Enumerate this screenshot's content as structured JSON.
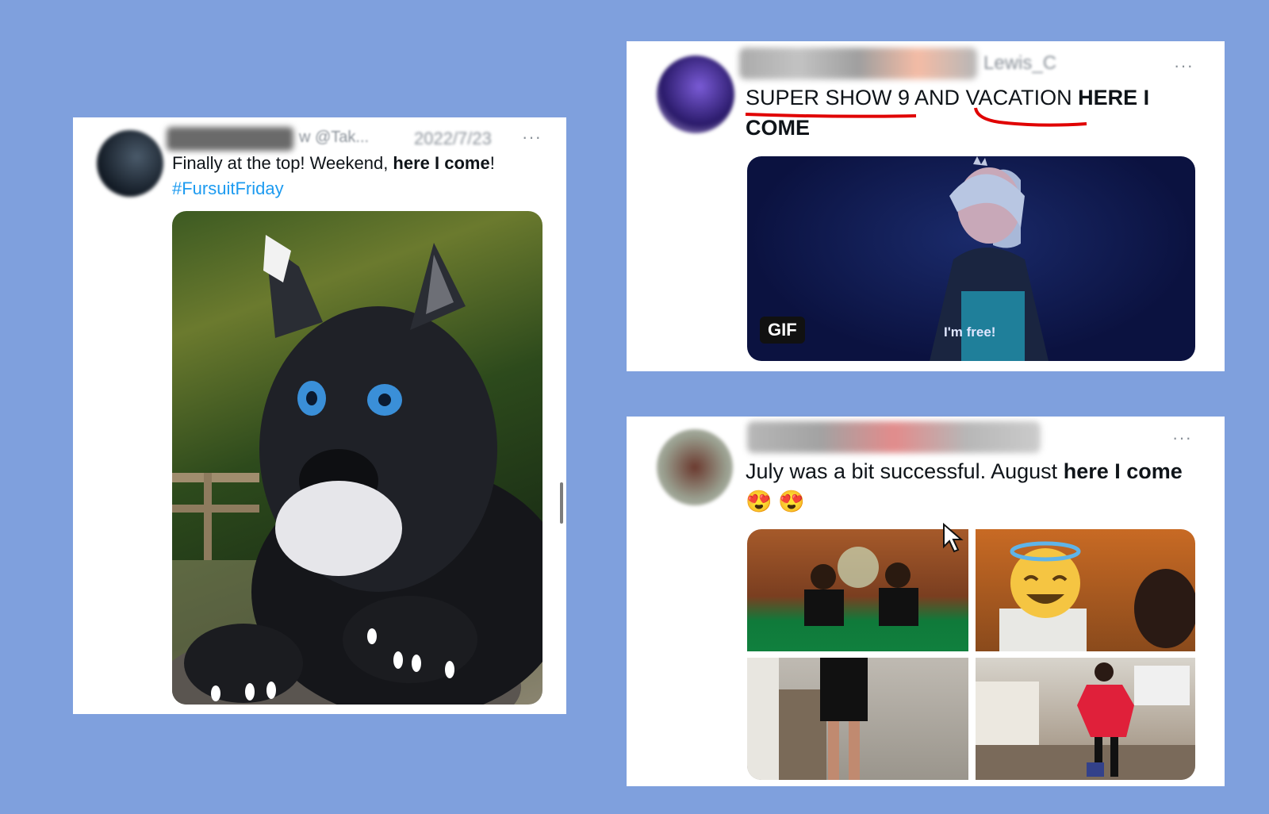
{
  "left_tweet": {
    "handle_visible": "w @Tak...",
    "date_visible": "2022/7/23",
    "more": "···",
    "text_plain": "Finally at the top! Weekend, ",
    "text_bold": "here I come",
    "text_end": "!",
    "hashtag": "#FursuitFriday"
  },
  "right_top_tweet": {
    "handle_visible": "Lewis_C",
    "more": "···",
    "text_plain": "SUPER SHOW 9 AND VACATION ",
    "text_bold": "HERE I COME",
    "gif_badge": "GIF",
    "gif_caption": "I'm free!"
  },
  "right_bottom_tweet": {
    "more": "···",
    "text_plain": "July was a bit successful. August ",
    "text_bold": "here I come",
    "emojis": "😍 😍"
  },
  "colors": {
    "background": "#7fa0dd",
    "hashtag": "#1d9bf0",
    "annotation_underline": "#e00000"
  }
}
